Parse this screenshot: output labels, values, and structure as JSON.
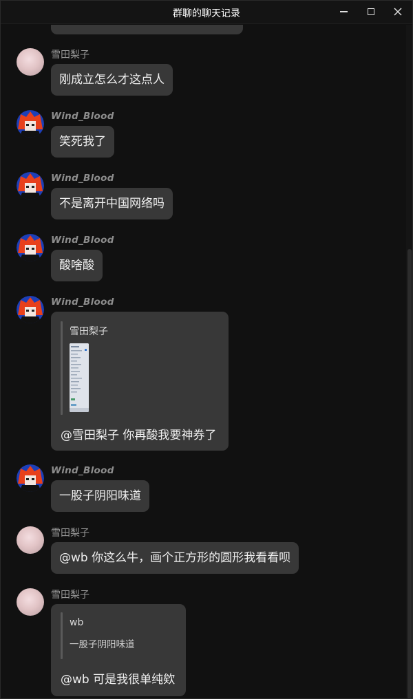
{
  "window": {
    "title": "群聊的聊天记录",
    "minimize_label": "—",
    "maximize_label": "□",
    "close_label": "✕"
  },
  "colors": {
    "background": "#111111",
    "bubble": "#383838",
    "sender_name": "#9a9a9a",
    "text": "#f0f0f0"
  },
  "messages": [
    {
      "sender": "雪田梨子",
      "avatar": "anime-girl-avatar",
      "text": "刚成立怎么才这点人"
    },
    {
      "sender": "Wind_Blood",
      "avatar": "red-hair-character-avatar",
      "text": "笑死我了"
    },
    {
      "sender": "Wind_Blood",
      "avatar": "red-hair-character-avatar",
      "text": "不是离开中国网络吗"
    },
    {
      "sender": "Wind_Blood",
      "avatar": "red-hair-character-avatar",
      "text": "酸啥酸"
    },
    {
      "sender": "Wind_Blood",
      "avatar": "red-hair-character-avatar",
      "quote": {
        "author": "雪田梨子",
        "content": "screenshot-thumbnail"
      },
      "text": "@雪田梨子 你再酸我要神券了"
    },
    {
      "sender": "Wind_Blood",
      "avatar": "red-hair-character-avatar",
      "text": "一股子阴阳味道"
    },
    {
      "sender": "雪田梨子",
      "avatar": "anime-girl-avatar",
      "text": "@wb 你这么牛，画个正方形的圆形我看看呗"
    },
    {
      "sender": "雪田梨子",
      "avatar": "anime-girl-avatar",
      "quote": {
        "author": "wb",
        "content": "一股子阴阳味道"
      },
      "text": "@wb 可是我很单纯欸"
    }
  ]
}
